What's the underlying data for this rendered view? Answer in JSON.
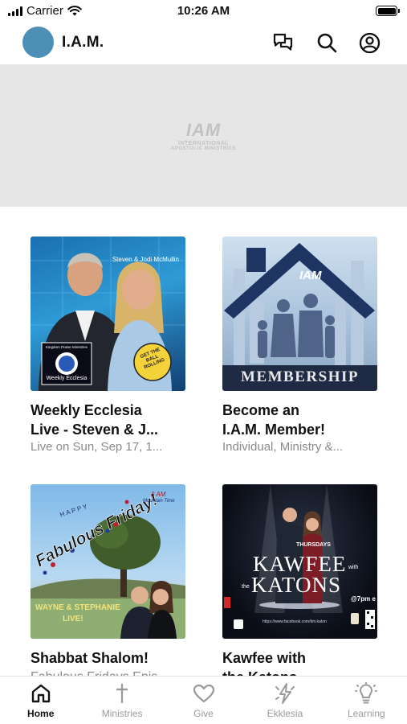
{
  "status_bar": {
    "carrier": "Carrier",
    "time": "10:26 AM"
  },
  "header": {
    "title": "I.A.M."
  },
  "banner": {
    "watermark_main": "IAM",
    "watermark_sub": "INTERNATIONAL",
    "watermark_sub2": "APOSTOLIC MINISTRIES"
  },
  "cards": [
    {
      "title_line1": "Weekly Ecclesia",
      "title_line2": "Live - Steven & J...",
      "subtitle": "Live on Sun, Sep 17, 1...",
      "image": {
        "caption": "Steven & Jodi McMullin",
        "badge_top": "Kingdom Praise Ministries",
        "badge_bottom": "Weekly Ecclesia",
        "sticker": "GET THE BALL ROLLING"
      }
    },
    {
      "title_line1": "Become an",
      "title_line2": "I.A.M. Member!",
      "subtitle": "Individual, Ministry &...",
      "image": {
        "logo": "IAM",
        "banner": "MEMBERSHIP"
      }
    },
    {
      "title_line1": "Shabbat Shalom!",
      "title_line2": "Fabulous Fridays Epis...",
      "image": {
        "happy": "HAPPY",
        "headline": "Fabulous Friday!",
        "time": "8 AM",
        "zone": "Mountain Time",
        "names": "WAYNE & STEPHANIE",
        "live": "LIVE!"
      }
    },
    {
      "title_line1": "Kawfee with",
      "title_line2": "the Katons",
      "image": {
        "day": "THURSDAYS",
        "word1": "KAWFEE",
        "with": "with",
        "the": "the",
        "word2": "KATONS",
        "time": "@7pm e",
        "url": "https://www.facebook.com/tim.katon"
      }
    }
  ],
  "tabs": [
    {
      "label": "Home",
      "icon": "home-icon",
      "active": true
    },
    {
      "label": "Ministries",
      "icon": "cross-icon"
    },
    {
      "label": "Give",
      "icon": "heart-icon"
    },
    {
      "label": "Ekklesia",
      "icon": "lightning-icon"
    },
    {
      "label": "Learning",
      "icon": "lightbulb-icon"
    }
  ],
  "colors": {
    "logo_blue": "#4e8fb5",
    "inactive": "#9a9a9a",
    "banner_bg": "#e6e6e6"
  }
}
